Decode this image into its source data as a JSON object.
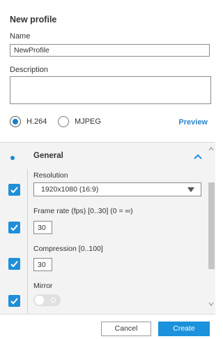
{
  "dialog": {
    "title": "New profile",
    "name_label": "Name",
    "name_value": "NewProfile",
    "description_label": "Description",
    "description_value": "",
    "codec_options": [
      {
        "label": "H.264",
        "selected": true
      },
      {
        "label": "MJPEG",
        "selected": false
      }
    ],
    "preview_link": "Preview"
  },
  "general": {
    "title": "General",
    "expanded": true,
    "resolution_label": "Resolution",
    "resolution_value": "1920x1080 (16:9)",
    "framerate_label": "Frame rate (fps) [0..30] (0 = ∞)",
    "framerate_value": "30",
    "compression_label": "Compression [0..100]",
    "compression_value": "30",
    "mirror_label": "Mirror",
    "mirror_on": false,
    "checkboxes_checked": [
      true,
      true,
      true,
      true
    ]
  },
  "footer": {
    "cancel_label": "Cancel",
    "create_label": "Create"
  },
  "colors": {
    "accent": "#1c91dc",
    "link": "#2a85c9",
    "panel_bg": "#f3f3f3"
  },
  "icons": [
    "radio-selected-icon",
    "radio-unselected-icon",
    "chevron-up-icon",
    "checkmark-icon",
    "dropdown-arrow-icon",
    "scroll-up-icon",
    "scroll-down-icon",
    "toggle-off-icon"
  ]
}
